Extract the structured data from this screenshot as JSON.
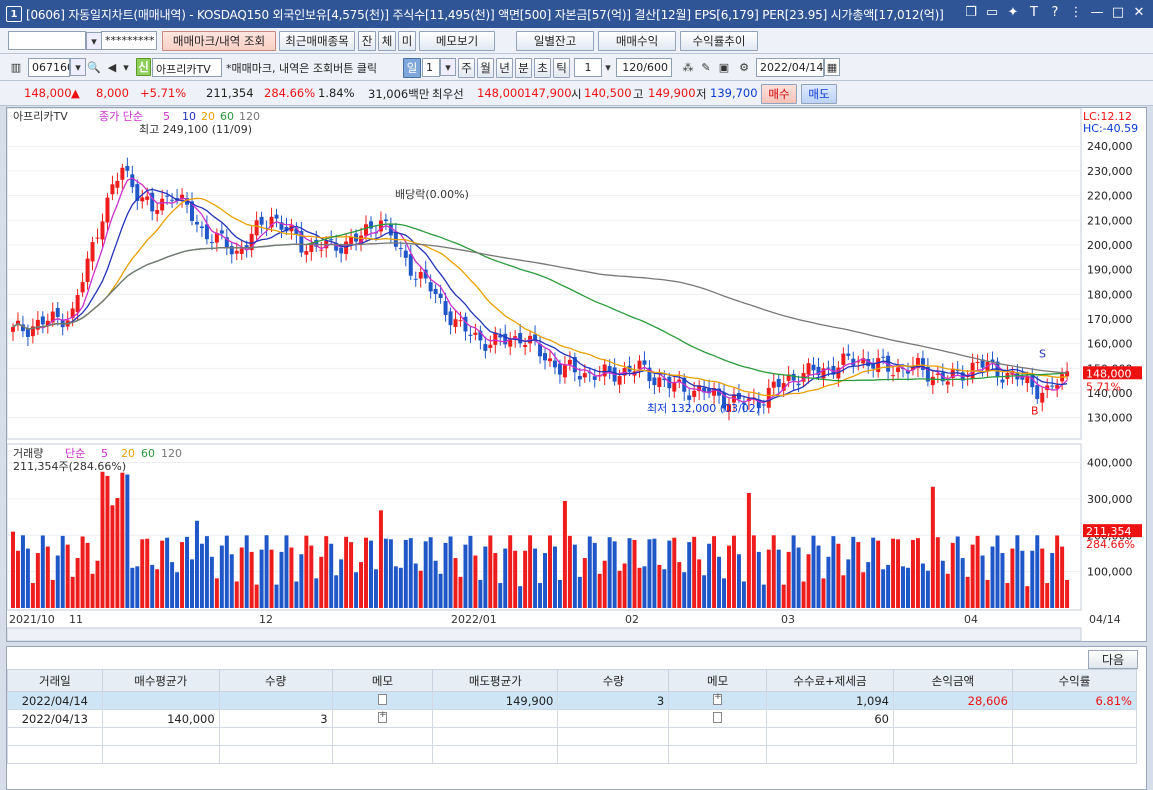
{
  "window": {
    "title": "[0606] 자동일지차트(매매내역) - KOSDAQ150 외국인보유[4,575(천)] 주식수[11,495(천)] 액면[500] 자본금[57(억)] 결산[12월] EPS[6,179] PER[23.95] 시가총액[17,012(억)]",
    "num": "1"
  },
  "toolbar1": {
    "password": "*********",
    "btn_mark": "매매마크/내역 조회",
    "btn_recent": "최근매매종목",
    "btn_jan": "잔",
    "btn_che": "체",
    "btn_mi": "미",
    "btn_memo": "메모보기",
    "btn_daily": "일별잔고",
    "btn_profit": "매매수익",
    "btn_trend": "수익률추이"
  },
  "toolbar2": {
    "code": "067160",
    "shin": "신",
    "stock_name": "아프리카TV",
    "notice": "*매매마크, 내역은 조회버튼 클릭",
    "period_sel": "일",
    "period_num": "1",
    "periods": [
      "주",
      "월",
      "년",
      "분",
      "초",
      "틱"
    ],
    "tick_num": "1",
    "count": "120/600",
    "date": "2022/04/14"
  },
  "quote": {
    "price": "148,000",
    "arrow": "▲",
    "change": "8,000",
    "rate": "+5.71%",
    "volume": "211,354",
    "vol_rate": "284.66%",
    "turnover": "1.84%",
    "amount": "31,006백만",
    "best_label": "최우선",
    "ask": "148,000",
    "bid": "147,900",
    "open_label": "시",
    "open": "140,500",
    "high_label": "고",
    "high": "149,900",
    "low_label": "저",
    "low": "139,700",
    "buy_btn": "매수",
    "sell_btn": "매도"
  },
  "chart": {
    "price_legend": {
      "name": "아프리카TV",
      "label": "종가 단순",
      "ma": [
        "5",
        "10",
        "20",
        "60",
        "120"
      ]
    },
    "volume_legend": {
      "name": "거래량",
      "label": "단순",
      "ma": [
        "5",
        "20",
        "60",
        "120"
      ],
      "current": "211,354주(284.66%)"
    },
    "lc": "LC:12.12",
    "hc": "HC:-40.59",
    "high_note": "최고 249,100 (11/09)",
    "low_note": "최저 132,000 (03/02)",
    "dividend_note": "배당락(0.00%)",
    "price_ticks": [
      "240,000",
      "230,000",
      "220,000",
      "210,000",
      "200,000",
      "190,000",
      "180,000",
      "170,000",
      "160,000",
      "150,000",
      "140,000",
      "130,000"
    ],
    "price_tag": "148,000",
    "price_tag_rate": "5.71%",
    "vol_ticks": [
      "400,000",
      "300,000",
      "200,000",
      "100,000"
    ],
    "vol_tag": "211,354",
    "vol_tag_rate": "284.66%",
    "x_labels": [
      "2021/10",
      "11",
      "12",
      "2022/01",
      "02",
      "03",
      "04"
    ],
    "x_right": "04/14",
    "marker_s": "S",
    "marker_b": "B",
    "colors": {
      "up": "#ee1c1c",
      "down": "#1f57c9",
      "ma5": "#cc2fcc",
      "ma10": "#2233bb",
      "ma20": "#e8a000",
      "ma60": "#2a9a3a",
      "ma120": "#777777"
    }
  },
  "table": {
    "next_btn": "다음",
    "headers": [
      "거래일",
      "매수평균가",
      "수량",
      "메모",
      "매도평균가",
      "수량",
      "메모",
      "수수료+제세금",
      "손익금액",
      "수익률"
    ],
    "rows": [
      {
        "date": "2022/04/14",
        "buy_avg": "",
        "buy_qty": "",
        "sell_avg": "149,900",
        "sell_qty": "3",
        "fee": "1,094",
        "pnl": "28,606",
        "rate": "6.81%"
      },
      {
        "date": "2022/04/13",
        "buy_avg": "140,000",
        "buy_qty": "3",
        "sell_avg": "",
        "sell_qty": "",
        "fee": "60",
        "pnl": "",
        "rate": ""
      }
    ]
  }
}
